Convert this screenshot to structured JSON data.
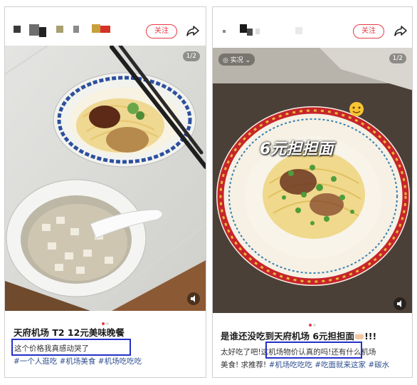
{
  "left_post": {
    "follow_label": "关注",
    "pager": "1/2",
    "title": "天府机场 T2 12元美味晚餐",
    "line1": "这个价格我真感动哭了",
    "tags": "#一个人逛吃 #机场美食 #机场吃吃吃"
  },
  "right_post": {
    "follow_label": "关注",
    "pager": "1/2",
    "live_chip": "实况",
    "overlay_text": "6元担担面",
    "title": "是谁还没吃到天府机场 6元担担面",
    "title_suffix": "!!!",
    "line1_a": "太好吃了吧!",
    "line1_b": "这机场物价认真的吗!",
    "line1_c": "还有什么机场",
    "line2_a": "美食! 求推荐!",
    "line2_tags": "#机场吃吃吃 #吃面就来这家 #碳水"
  },
  "colors": {
    "accent_red": "#e63b43",
    "highlight_blue": "#2430c8",
    "tag_blue": "#2f4f8f"
  },
  "icons": [
    "share-icon",
    "sound-icon",
    "cake-emoji",
    "smile-emoji",
    "chevron-down-icon",
    "camera-icon"
  ]
}
